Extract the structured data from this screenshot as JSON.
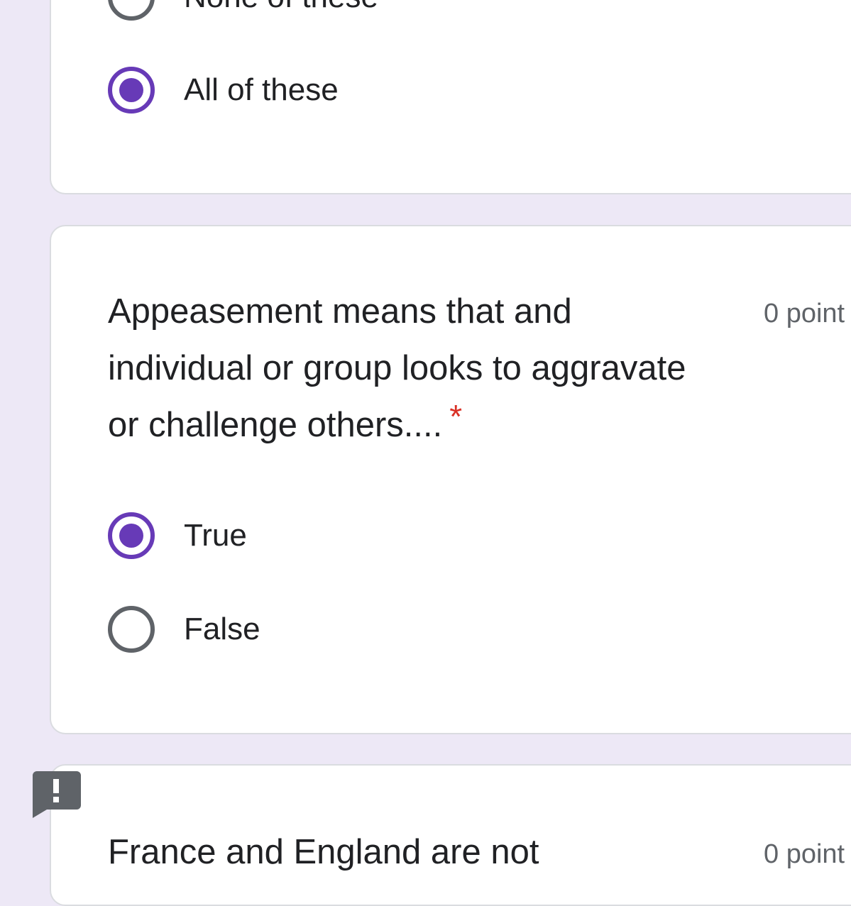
{
  "questions": [
    {
      "options": [
        {
          "label": "None of these",
          "selected": false
        },
        {
          "label": "All of these",
          "selected": true
        }
      ]
    },
    {
      "title": "Appeasement means that and individual or group looks to aggravate or challenge others....",
      "required_marker": "*",
      "points": "0 point",
      "options": [
        {
          "label": "True",
          "selected": true
        },
        {
          "label": "False",
          "selected": false
        }
      ]
    },
    {
      "title": "France and England are not",
      "points": "0 point"
    }
  ],
  "colors": {
    "accent": "#673ab7",
    "background": "#ede8f6",
    "required": "#d93025"
  },
  "icons": {
    "report": "report-problem-icon"
  }
}
